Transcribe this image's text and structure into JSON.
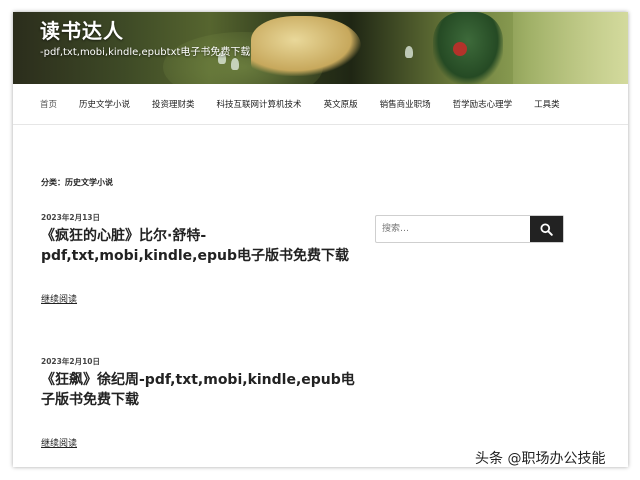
{
  "site": {
    "title": "读书达人",
    "description": "-pdf,txt,mobi,kindle,epubtxt电子书免费下载"
  },
  "nav": {
    "items": [
      {
        "label": "首页"
      },
      {
        "label": "历史文学小说"
      },
      {
        "label": "投资理财类"
      },
      {
        "label": "科技互联网计算机技术"
      },
      {
        "label": "英文原版"
      },
      {
        "label": "销售商业职场"
      },
      {
        "label": "哲学励志心理学"
      },
      {
        "label": "工具类"
      }
    ]
  },
  "archive": {
    "title": "分类：历史文学小说"
  },
  "posts": [
    {
      "date": "2023年2月13日",
      "title": "《疯狂的心脏》比尔·舒特-pdf,txt,mobi,kindle,epub电子版书免费下载",
      "read_more": "继续阅读"
    },
    {
      "date": "2023年2月10日",
      "title": "《狂飙》徐纪周-pdf,txt,mobi,kindle,epub电子版书免费下载",
      "read_more": "继续阅读"
    }
  ],
  "search": {
    "placeholder": "搜索…",
    "icon": "search-icon"
  },
  "watermark": "头条 @职场办公技能",
  "colors": {
    "text": "#222222",
    "button": "#222222"
  }
}
